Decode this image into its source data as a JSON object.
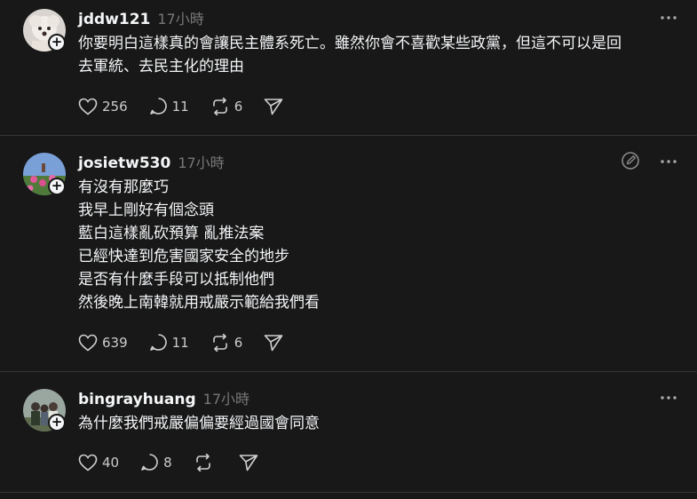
{
  "posts": [
    {
      "username": "jddw121",
      "time": "17小時",
      "text": "你要明白這樣真的會讓民主體系死亡。雖然你會不喜歡某些政黨，但這不可以是回\n去軍統、去民主化的理由",
      "likes": "256",
      "replies": "11",
      "reposts": "6"
    },
    {
      "username": "josietw530",
      "time": "17小時",
      "text": "有沒有那麼巧\n我早上剛好有個念頭\n藍白這樣亂砍預算 亂推法案\n已經快達到危害國家安全的地步\n是否有什麼手段可以抵制他們\n然後晚上南韓就用戒嚴示範給我們看",
      "likes": "639",
      "replies": "11",
      "reposts": "6"
    },
    {
      "username": "bingrayhuang",
      "time": "17小時",
      "text": "為什麼我們戒嚴偏偏要經過國會同意",
      "likes": "40",
      "replies": "8",
      "reposts": ""
    }
  ],
  "icons": {
    "like": "heart-icon",
    "reply": "comment-icon",
    "repost": "repost-icon",
    "share": "send-icon",
    "more": "more-dots-icon",
    "follow": "plus-icon",
    "edit": "edit-icon"
  },
  "colors": {
    "background": "#181818",
    "text": "#f3f5f7",
    "muted": "#777777",
    "divider": "#333638"
  }
}
